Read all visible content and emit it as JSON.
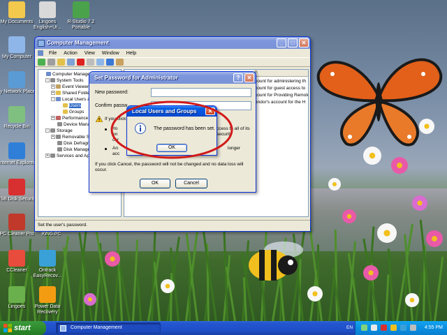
{
  "desktop_icons": [
    {
      "label": "My Documents",
      "color": "#f2c94c"
    },
    {
      "label": "Lingoes English+Ur...",
      "color": "#d9d9d9"
    },
    {
      "label": "R-Studio 7.2 Portable",
      "color": "#4aa34a"
    },
    {
      "label": "My Computer",
      "color": "#8fb6e8"
    },
    {
      "label": "My Network Places",
      "color": "#5b9bd5"
    },
    {
      "label": "Recycle Bin",
      "color": "#7fbf7f"
    },
    {
      "label": "Internet Explorer",
      "color": "#2f7fd8"
    },
    {
      "label": "USB Disk Security",
      "color": "#d83030"
    },
    {
      "label": "PC Cleaner Pro",
      "color": "#c0392b"
    },
    {
      "label": "CCleaner",
      "color": "#e74c3c"
    },
    {
      "label": "Ontrack EasyRecov...",
      "color": "#3aa0d8"
    },
    {
      "label": "Lingoes",
      "color": "#6ab04c"
    },
    {
      "label": "Power Data Recovery",
      "color": "#f39c12"
    }
  ],
  "computer_management": {
    "title": "Computer Management",
    "menu": [
      "File",
      "Action",
      "View",
      "Window",
      "Help"
    ],
    "tree": [
      {
        "label": "Computer Manageme",
        "indent": 0,
        "expander": "",
        "icon": "#6b8cc8"
      },
      {
        "label": "System Tools",
        "indent": 1,
        "expander": "-",
        "icon": "#8a8a8a"
      },
      {
        "label": "Event Viewer",
        "indent": 2,
        "expander": "+",
        "icon": "#c0a060"
      },
      {
        "label": "Shared Folde",
        "indent": 2,
        "expander": "+",
        "icon": "#e2c14a"
      },
      {
        "label": "Local Users a",
        "indent": 2,
        "expander": "-",
        "icon": "#6b8cc8"
      },
      {
        "label": "Users",
        "indent": 3,
        "expander": "",
        "icon": "#e2c14a",
        "selected": true
      },
      {
        "label": "Groups",
        "indent": 3,
        "expander": "",
        "icon": "#e2c14a"
      },
      {
        "label": "Performance",
        "indent": 2,
        "expander": "+",
        "icon": "#c06060"
      },
      {
        "label": "Device Manag",
        "indent": 2,
        "expander": "",
        "icon": "#8a8a8a"
      },
      {
        "label": "Storage",
        "indent": 1,
        "expander": "-",
        "icon": "#8a8a8a"
      },
      {
        "label": "Removable S",
        "indent": 2,
        "expander": "+",
        "icon": "#8a8a8a"
      },
      {
        "label": "Disk Defragm",
        "indent": 2,
        "expander": "",
        "icon": "#8a8a8a"
      },
      {
        "label": "Disk Manager",
        "indent": 2,
        "expander": "",
        "icon": "#8a8a8a"
      },
      {
        "label": "Services and App",
        "indent": 1,
        "expander": "+",
        "icon": "#8a8a8a"
      }
    ],
    "right_header": "n",
    "right_rows": [
      "count for administering th",
      "count for guest access to",
      "count for Providing Remote Assi",
      "endor's account for the H"
    ],
    "status": "Set the user's password.",
    "bottom_label": "KING-PC"
  },
  "set_password": {
    "title": "Set Password for Administrator",
    "new_password_label": "New password:",
    "confirm_password_label": "Confirm passw",
    "warn_line": "If you click",
    "bullet1_a": "Yo",
    "bullet1_b": "ccess to all of its",
    "bullet1_c": "en",
    "bullet1_d": "security",
    "bullet1_e": "cer",
    "bullet2_a": "An",
    "bullet2_b": "longer",
    "bullet2_c": "acc",
    "cancel_note": "If you click Cancel, the password will not be changed and no data loss will occur.",
    "ok_label": "OK",
    "cancel_label": "Cancel"
  },
  "message_box": {
    "title": "Local Users and Groups",
    "message": "The password has been set.",
    "ok_label": "OK"
  },
  "taskbar": {
    "start_label": "start",
    "task_label": "Computer Management",
    "lang": "EN",
    "clock": "4:55 PM"
  },
  "colors": {
    "highlight_ellipse": "#d11a1a",
    "xp_blue": "#0054e3"
  }
}
